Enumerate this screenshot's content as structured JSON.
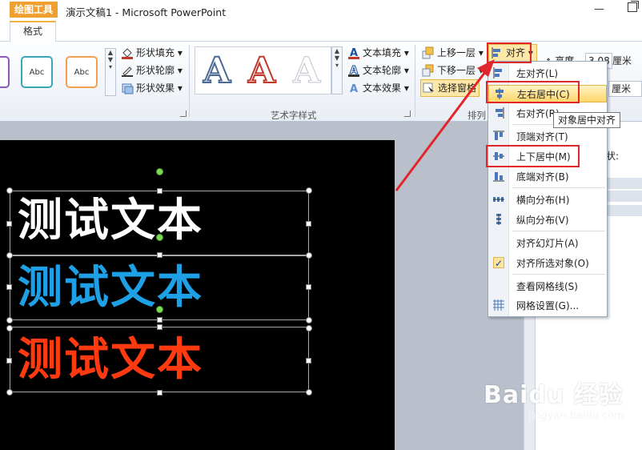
{
  "titlebar": {
    "context_tab": "绘图工具",
    "title": "演示文稿1 - Microsoft PowerPoint"
  },
  "ribbon": {
    "active_tab": "格式",
    "shape_styles": {
      "sample_text": "Abc",
      "fill": "形状填充",
      "outline": "形状轮廓",
      "effects": "形状效果"
    },
    "wordart": {
      "fill": "文本填充",
      "outline": "文本轮廓",
      "effects": "文本效果",
      "group_label": "艺术字样式",
      "sample_glyph": "A"
    },
    "arrange": {
      "bring_forward": "上移一层",
      "send_backward": "下移一层",
      "selection_pane": "选择窗格",
      "align": "对齐",
      "group_label": "排列"
    },
    "size": {
      "height_label": "高度",
      "height_value": "3.08",
      "unit": "厘米"
    }
  },
  "slide": {
    "texts": [
      {
        "text": "测试文本",
        "color": "#ffffff"
      },
      {
        "text": "测试文本",
        "color": "#1ea0e6"
      },
      {
        "text": "测试文本",
        "color": "#ff3a10"
      }
    ]
  },
  "side_pane": {
    "partial_label": "状:"
  },
  "align_menu": {
    "items": [
      {
        "label": "左对齐(L)",
        "icon": "align-left-icon"
      },
      {
        "label": "左右居中(C)",
        "icon": "align-center-icon",
        "highlighted": true
      },
      {
        "label": "右对齐(R)",
        "icon": "align-right-icon"
      },
      {
        "label": "顶端对齐(T)",
        "icon": "align-top-icon"
      },
      {
        "label": "上下居中(M)",
        "icon": "align-middle-icon"
      },
      {
        "label": "底端对齐(B)",
        "icon": "align-bottom-icon"
      },
      {
        "label": "横向分布(H)",
        "icon": "distribute-horizontal-icon"
      },
      {
        "label": "纵向分布(V)",
        "icon": "distribute-vertical-icon"
      },
      {
        "label": "对齐幻灯片(A)",
        "icon": ""
      },
      {
        "label": "对齐所选对象(O)",
        "icon": "checkmark-icon",
        "checked": true
      },
      {
        "label": "查看网格线(S)",
        "icon": ""
      },
      {
        "label": "网格设置(G)...",
        "icon": "grid-icon"
      }
    ],
    "tooltip": "对象居中对齐"
  },
  "watermark": {
    "logo": "Baidu 经验",
    "url": "jingyan.baidu.com"
  },
  "colors": {
    "annotation_red": "#e0262b",
    "highlight": "#ffd76b",
    "slide_bg": "#000000"
  }
}
